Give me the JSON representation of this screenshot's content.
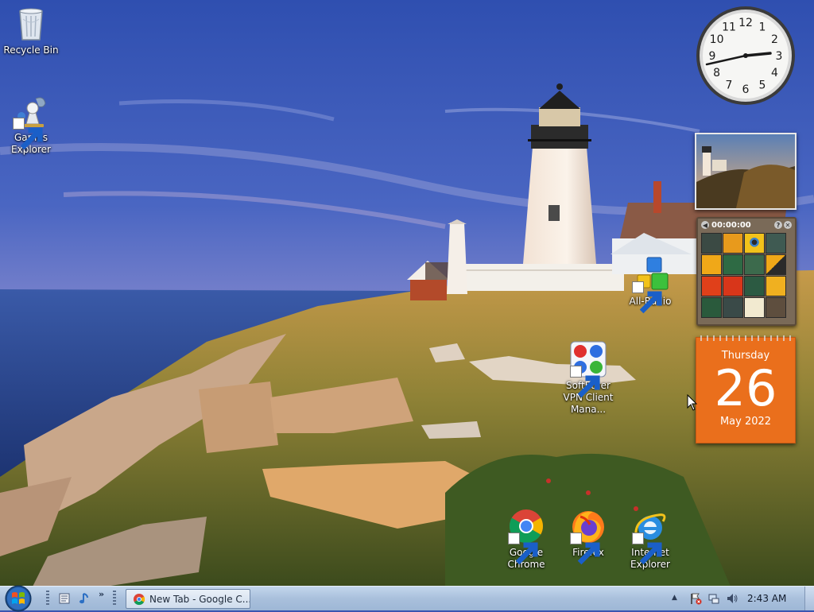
{
  "desktop": {
    "icons": {
      "recycle_bin": "Recycle Bin",
      "games_explorer": "Games Explorer",
      "all_radio": "All-Radio",
      "softether": "SoftEther VPN Client Mana...",
      "chrome": "Google Chrome",
      "firefox": "Firefox",
      "ie": "Internet Explorer"
    }
  },
  "gadgets": {
    "clock": {
      "numbers": [
        "12",
        "1",
        "2",
        "3",
        "4",
        "5",
        "6",
        "7",
        "8",
        "9",
        "10",
        "11"
      ],
      "time": "2:43"
    },
    "puzzle": {
      "timer": "00:00:00",
      "help_glyph": "?",
      "close_glyph": "✕"
    },
    "calendar": {
      "weekday": "Thursday",
      "day": "26",
      "month_year": "May 2022"
    }
  },
  "taskbar": {
    "window_button": "New Tab - Google C...",
    "clock": "2:43 AM",
    "quick_launch_more": "»",
    "tray_show_hidden": "▲"
  },
  "colors": {
    "taskbar": "#b4c8e2",
    "calendar": "#ea6f1c",
    "sky_top": "#3a55b0",
    "sea": "#2f4a8a"
  }
}
